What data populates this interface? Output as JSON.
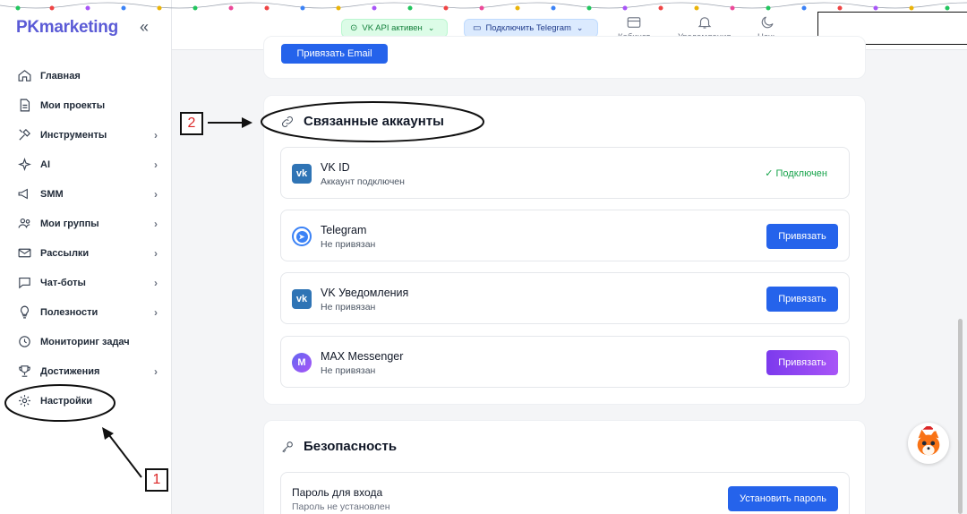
{
  "app": {
    "logo": "PKmarketing"
  },
  "sidebar": {
    "items": [
      {
        "label": "Главная",
        "icon": "home-icon",
        "chevron": false
      },
      {
        "label": "Мои проекты",
        "icon": "document-icon",
        "chevron": false
      },
      {
        "label": "Инструменты",
        "icon": "tools-icon",
        "chevron": true
      },
      {
        "label": "AI",
        "icon": "sparkles-icon",
        "chevron": true
      },
      {
        "label": "SMM",
        "icon": "megaphone-icon",
        "chevron": true
      },
      {
        "label": "Мои группы",
        "icon": "users-icon",
        "chevron": true
      },
      {
        "label": "Рассылки",
        "icon": "mail-icon",
        "chevron": true
      },
      {
        "label": "Чат-боты",
        "icon": "chat-icon",
        "chevron": true
      },
      {
        "label": "Полезности",
        "icon": "lightbulb-icon",
        "chevron": true
      },
      {
        "label": "Мониторинг задач",
        "icon": "clock-icon",
        "chevron": false
      },
      {
        "label": "Достижения",
        "icon": "trophy-icon",
        "chevron": true
      },
      {
        "label": "Настройки",
        "icon": "gear-icon",
        "chevron": false
      }
    ]
  },
  "topbar": {
    "vk_status": "VK API активен",
    "telegram": "Подключить Telegram",
    "cabinet": "Кабинет",
    "notifications": "Уведомления",
    "night": "Ночь"
  },
  "main": {
    "email_button": "Привязать Email",
    "linked": {
      "title": "Связанные аккаунты",
      "accounts": [
        {
          "name": "VK ID",
          "status": "Аккаунт подключен",
          "connected_label": "✓ Подключен"
        },
        {
          "name": "Telegram",
          "status": "Не привязан",
          "button": "Привязать"
        },
        {
          "name": "VK Уведомления",
          "status": "Не привязан",
          "button": "Привязать"
        },
        {
          "name": "MAX Messenger",
          "status": "Не привязан",
          "button": "Привязать",
          "icon_letter": "M"
        }
      ]
    },
    "security": {
      "title": "Безопасность",
      "password_label": "Пароль для входа",
      "password_status": "Пароль не установлен",
      "button": "Установить пароль"
    }
  },
  "annotations": {
    "one": "1",
    "two": "2"
  },
  "colors": {
    "brand": "#5b5bd6",
    "primary": "#2563eb",
    "success": "#16a34a",
    "annotation": "#dc2626"
  }
}
